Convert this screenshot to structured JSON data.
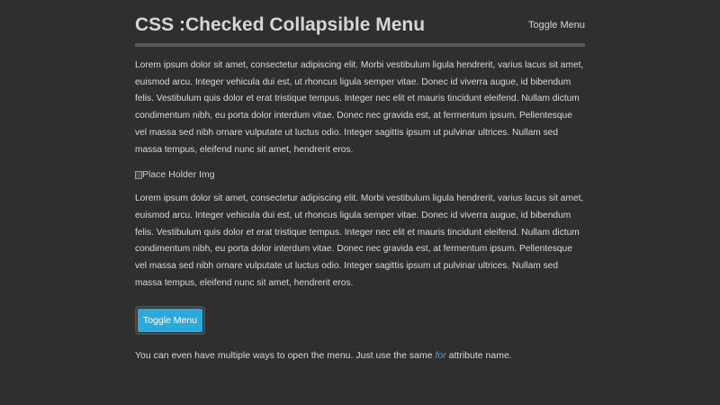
{
  "header": {
    "title": "CSS :Checked Collapsible Menu",
    "toggle_link": "Toggle Menu"
  },
  "content": {
    "paragraph_1": "Lorem ipsum dolor sit amet, consectetur adipiscing elit. Morbi vestibulum ligula hendrerit, varius lacus sit amet, euismod arcu. Integer vehicula dui est, ut rhoncus ligula semper vitae. Donec id viverra augue, id bibendum felis. Vestibulum quis dolor et erat tristique tempus. Integer nec elit et mauris tincidunt eleifend. Nullam dictum condimentum nibh, eu porta dolor interdum vitae. Donec nec gravida est, at fermentum ipsum. Pellentesque vel massa sed nibh ornare vulputate ut luctus odio. Integer sagittis ipsum ut pulvinar ultrices. Nullam sed massa tempus, eleifend nunc sit amet, hendrerit eros.",
    "image_alt": "Place Holder Img",
    "paragraph_2": "Lorem ipsum dolor sit amet, consectetur adipiscing elit. Morbi vestibulum ligula hendrerit, varius lacus sit amet, euismod arcu. Integer vehicula dui est, ut rhoncus ligula semper vitae. Donec id viverra augue, id bibendum felis. Vestibulum quis dolor et erat tristique tempus. Integer nec elit et mauris tincidunt eleifend. Nullam dictum condimentum nibh, eu porta dolor interdum vitae. Donec nec gravida est, at fermentum ipsum. Pellentesque vel massa sed nibh ornare vulputate ut luctus odio. Integer sagittis ipsum ut pulvinar ultrices. Nullam sed massa tempus, eleifend nunc sit amet, hendrerit eros.",
    "toggle_button": "Toggle Menu",
    "note_before": "You can even have multiple ways to open the menu. Just use the same ",
    "note_attr": "for",
    "note_after": " attribute name."
  },
  "colors": {
    "background": "#2f2f2f",
    "accent": "#2fa9d9",
    "link_attr": "#3aaee0"
  }
}
